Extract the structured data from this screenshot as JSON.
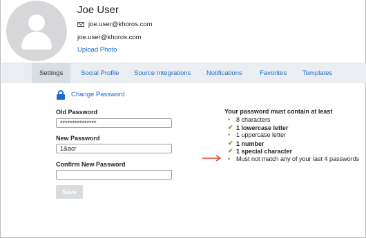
{
  "profile": {
    "name": "Joe User",
    "email": "joe.user@khoros.com",
    "login": "joe.user@khoros.com",
    "upload_label": "Upload Photo"
  },
  "tabs": [
    {
      "label": "Settings",
      "active": true
    },
    {
      "label": "Social Profile"
    },
    {
      "label": "Source Integrations"
    },
    {
      "label": "Notifications"
    },
    {
      "label": "Favorites"
    },
    {
      "label": "Templates"
    }
  ],
  "password_form": {
    "heading": "Change Password",
    "old_label": "Old Password",
    "old_value": "***************",
    "new_label": "New Password",
    "new_value": "1&acr",
    "confirm_label": "Confirm New Password",
    "confirm_value": "",
    "save_label": "Save"
  },
  "requirements": {
    "title": "Your password must contain at least",
    "items": [
      {
        "text": "8 characters",
        "met": false
      },
      {
        "text": "1 lowercase letter",
        "met": true
      },
      {
        "text": "1 uppercase letter",
        "met": false
      },
      {
        "text": "1 number",
        "met": true
      },
      {
        "text": "1 special character",
        "met": true
      },
      {
        "text": "Must not match any of your last 4 passwords",
        "met": false
      }
    ]
  },
  "colors": {
    "link": "#1b6ad1",
    "check": "#6aa11f",
    "arrow": "#e8412c"
  },
  "icons": {
    "avatar": "user-silhouette",
    "email": "envelope-icon",
    "lock": "lock-icon",
    "bullet": "•",
    "check": "✔"
  }
}
